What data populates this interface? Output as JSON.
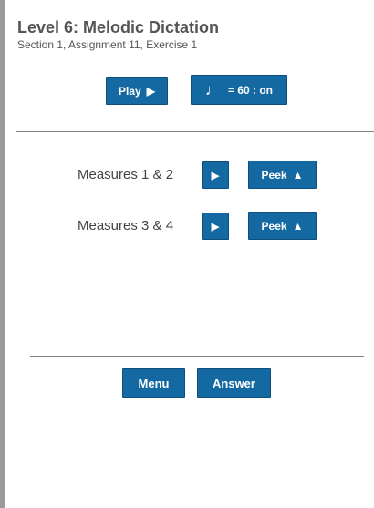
{
  "header": {
    "title": "Level 6: Melodic Dictation",
    "subtitle": "Section 1, Assignment 11, Exercise 1"
  },
  "controls": {
    "play_label": "Play",
    "play_icon": "▶",
    "tempo_note": "♩",
    "tempo_label": "= 60 : on"
  },
  "measures": [
    {
      "label": "Measures 1 & 2",
      "play_icon": "▶",
      "peek_label": "Peek",
      "peek_icon": "▲"
    },
    {
      "label": "Measures 3 & 4",
      "play_icon": "▶",
      "peek_label": "Peek",
      "peek_icon": "▲"
    }
  ],
  "footer": {
    "menu_label": "Menu",
    "answer_label": "Answer"
  },
  "colors": {
    "button_blue": "#1569a2",
    "text_gray": "#555555",
    "left_border": "#9a9a9a"
  }
}
